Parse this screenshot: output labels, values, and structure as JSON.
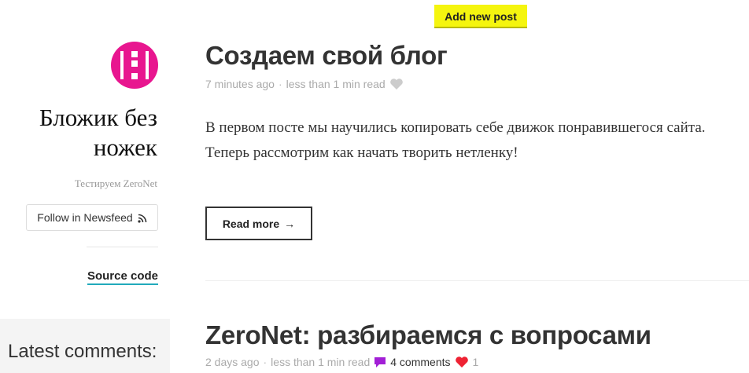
{
  "toolbar": {
    "add_post_label": "Add new post"
  },
  "sidebar": {
    "blog_title": "Бложик без ножек",
    "blog_subtitle": "Тестируем ZeroNet",
    "follow_label": "Follow in Newsfeed",
    "source_code_label": "Source code",
    "latest_comments_title": "Latest comments:"
  },
  "posts": [
    {
      "title": "Создаем свой блог",
      "date": "7 minutes ago",
      "read_time": "less than 1 min read",
      "body": "В первом посте мы научились копировать себе движок понравившегося сайта. Теперь рассмотрим как начать творить нетленку!",
      "read_more_label": "Read more",
      "read_more_arrow": "→"
    },
    {
      "title": "ZeroNet: разбираемся с вопросами",
      "date": "2 days ago",
      "read_time": "less than 1 min read",
      "comments": "4 comments",
      "likes": "1"
    }
  ],
  "meta_separator": "·",
  "colors": {
    "accent_yellow": "#f5f50f",
    "avatar_pink": "#e8168f",
    "link_underline": "#22aabb",
    "heart_red": "#ee2233",
    "comment_purple": "#a21fd6"
  }
}
